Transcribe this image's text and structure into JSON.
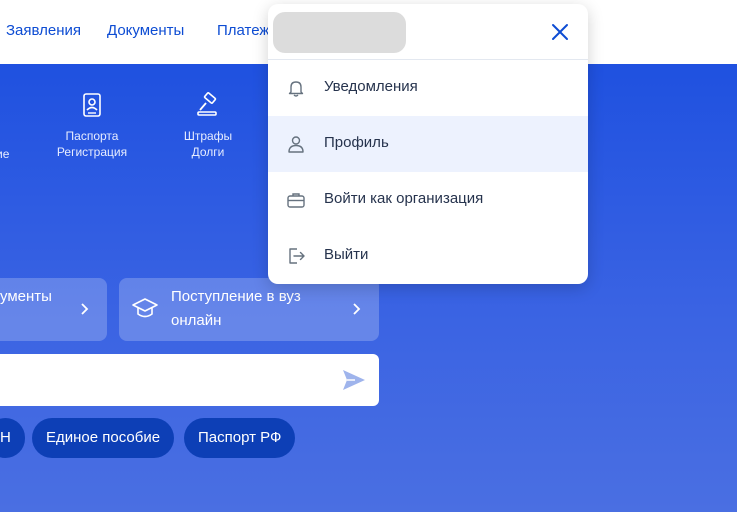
{
  "nav": {
    "links": [
      "Заявления",
      "Документы",
      "Платежи"
    ]
  },
  "services": [
    {
      "icon": "passport-icon",
      "line1": "Паспорта",
      "line2": "Регистрация"
    },
    {
      "icon": "gavel-icon",
      "line1": "Штрафы",
      "line2": "Долги"
    }
  ],
  "partial_service_label": "ие",
  "tiles": [
    {
      "label_line1": "ументы",
      "label_line2": ""
    },
    {
      "label_line1": "Поступление в вуз",
      "label_line2": "онлайн",
      "icon": "graduation-cap-icon"
    }
  ],
  "search": {
    "placeholder": "",
    "icon": "send-icon"
  },
  "chips": [
    "Н",
    "Единое пособие",
    "Паспорт РФ"
  ],
  "menu": {
    "items": [
      {
        "label": "Уведомления",
        "icon": "bell-icon"
      },
      {
        "label": "Профиль",
        "icon": "user-icon",
        "active": true
      },
      {
        "label": "Войти как организация",
        "icon": "briefcase-icon"
      },
      {
        "label": "Выйти",
        "icon": "logout-icon"
      }
    ],
    "close_icon": "close-icon"
  },
  "colors": {
    "accent": "#0d4cd3",
    "hero_top": "#1f51e0",
    "hero_bottom": "#4a6fe2",
    "chip_bg": "#0d3fb6",
    "menu_active": "#edf2fe"
  }
}
